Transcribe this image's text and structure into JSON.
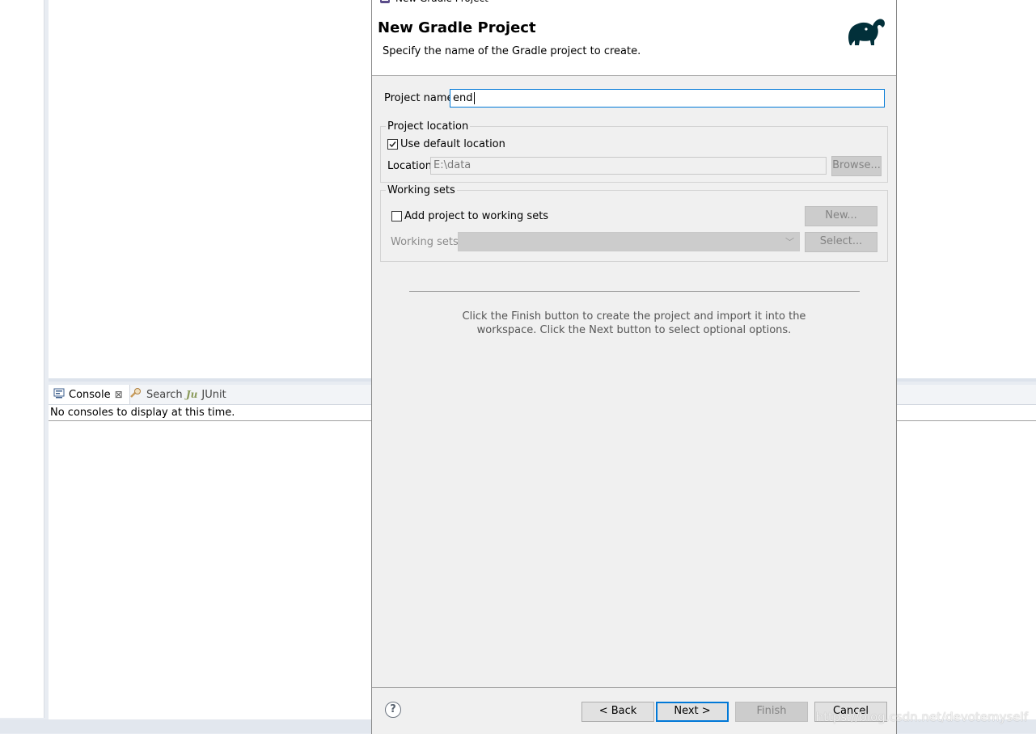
{
  "workspace": {
    "tabs": [
      {
        "label": "Console",
        "close": "⊠"
      },
      {
        "label": "Search"
      },
      {
        "label": "JUnit"
      }
    ],
    "console_message": "No consoles to display at this time.",
    "watermark": "https://blog.csdn.net/devotemyself"
  },
  "dialog": {
    "window_title": "New Gradle Project",
    "header_title": "New Gradle Project",
    "header_description": "Specify the name of the Gradle project to create.",
    "project_name_label": "Project name",
    "project_name_value": "end",
    "location_group_label": "Project location",
    "use_default_location_label": "Use default location",
    "use_default_location_checked": true,
    "location_label": "Location",
    "location_value": "E:\\data",
    "browse_label": "Browse...",
    "working_sets_group_label": "Working sets",
    "add_to_working_sets_label": "Add project to working sets",
    "add_to_working_sets_checked": false,
    "new_label": "New...",
    "working_sets_label": "Working sets",
    "select_label": "Select...",
    "info_line1": "Click the Finish button to create the project and import it into the",
    "info_line2": "workspace. Click the Next button to select optional options.",
    "back_label": "< Back",
    "next_label": "Next >",
    "finish_label": "Finish",
    "cancel_label": "Cancel",
    "help_symbol": "?"
  },
  "colors": {
    "accent": "#0078d7",
    "dialog_bg": "#f0f0f0",
    "gradle_logo": "#02303a"
  },
  "icons": [
    "gradle-elephant-icon",
    "console-icon",
    "search-icon",
    "junit-icon",
    "help-icon",
    "minimize-icon",
    "maximize-icon",
    "close-icon"
  ]
}
